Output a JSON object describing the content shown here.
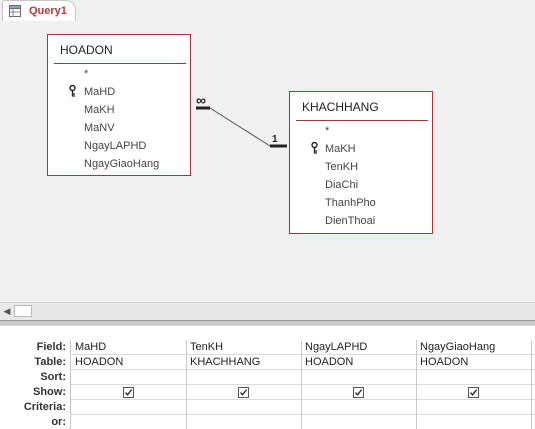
{
  "tab": {
    "icon": "query-icon",
    "label": "Query1"
  },
  "tables": [
    {
      "name": "HOADON",
      "fields": [
        "*",
        "MaHD",
        "MaKH",
        "MaNV",
        "NgayLAPHD",
        "NgayGiaoHang"
      ],
      "key_field": "MaHD"
    },
    {
      "name": "KHACHHANG",
      "fields": [
        "*",
        "MaKH",
        "TenKH",
        "DiaChi",
        "ThanhPho",
        "DienThoai"
      ],
      "key_field": "MaKH"
    }
  ],
  "relationship": {
    "from_table": "HOADON",
    "to_table": "KHACHHANG",
    "from_symbol": "∞",
    "to_symbol": "1"
  },
  "grid": {
    "row_labels": [
      "Field:",
      "Table:",
      "Sort:",
      "Show:",
      "Criteria:",
      "or:"
    ],
    "columns": [
      {
        "field": "MaHD",
        "table": "HOADON",
        "sort": "",
        "show": true
      },
      {
        "field": "TenKH",
        "table": "KHACHHANG",
        "sort": "",
        "show": true
      },
      {
        "field": "NgayLAPHD",
        "table": "HOADON",
        "sort": "",
        "show": true
      },
      {
        "field": "NgayGiaoHang",
        "table": "HOADON",
        "sort": "",
        "show": true
      }
    ]
  },
  "colors": {
    "table_border": "#a4373a",
    "tab_label": "#b4393b"
  }
}
